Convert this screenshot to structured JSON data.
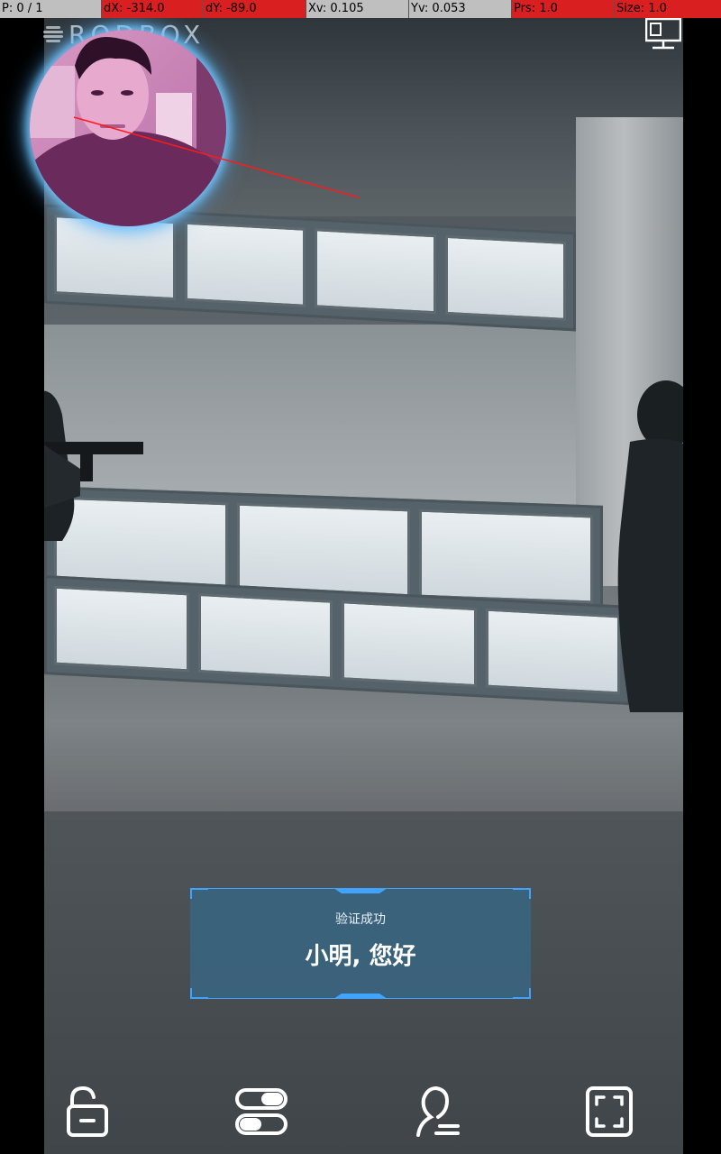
{
  "debug_bar": {
    "pointer": "P: 0 / 1",
    "dx": "dX: -314.0",
    "dy": "dY: -89.0",
    "xv": "Xv: 0.105",
    "yv": "Yv: 0.053",
    "prs": "Prs: 1.0",
    "size": "Size: 1.0",
    "colors": {
      "neutral": "#bfbfbf",
      "alert": "#d91f1f"
    }
  },
  "brand": {
    "name": "RODBOX"
  },
  "result": {
    "status": "验证成功",
    "greeting": "小明, 您好",
    "accent": "#3fa3ff"
  },
  "icons": {
    "network": "network-display-icon",
    "unlock": "unlock-icon",
    "toggle": "toggle-switch-icon",
    "user": "user-signature-icon",
    "fullscreen": "fullscreen-icon"
  }
}
